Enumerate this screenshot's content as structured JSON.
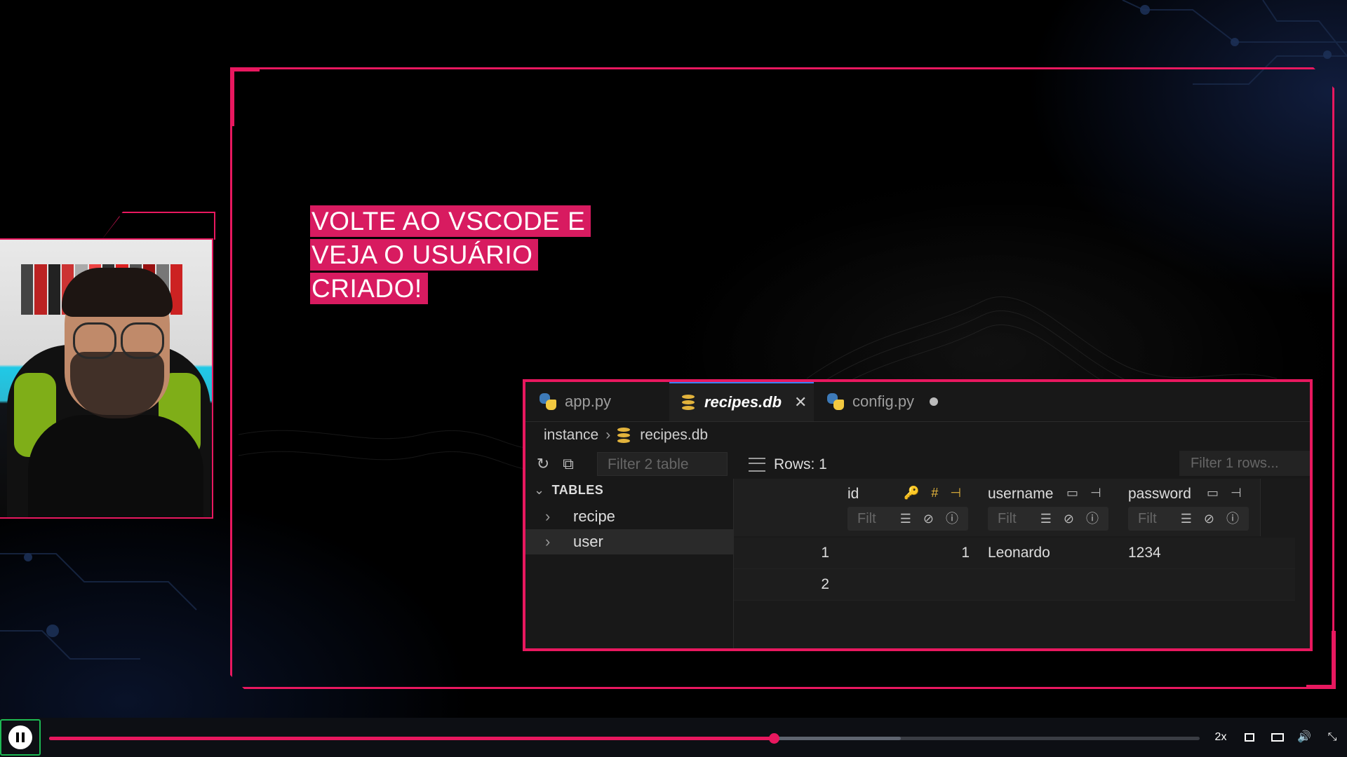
{
  "callout": {
    "lines": [
      "VOLTE AO VSCODE E",
      "VEJA O USUÁRIO",
      "CRIADO!"
    ]
  },
  "editor": {
    "tabs": [
      {
        "label": "app.py",
        "icon": "python-icon"
      },
      {
        "label": "recipes.db",
        "icon": "database-icon",
        "active": true,
        "close": "✕"
      },
      {
        "label": "config.py",
        "icon": "python-icon",
        "unsaved_indicator": "●"
      }
    ],
    "breadcrumb": {
      "folder": "instance",
      "file": "recipes.db",
      "separator": "›"
    },
    "filter_tables_placeholder": "Filter 2 table",
    "rows_label": "Rows: 1",
    "filter_rows_placeholder": "Filter 1 rows...",
    "sidebar": {
      "heading": "TABLES",
      "tables": [
        "recipe",
        "user"
      ],
      "selected_table": "user"
    },
    "grid": {
      "columns": [
        {
          "name": "id",
          "icons": "🔑 # ⊣",
          "filter_placeholder": "Filt"
        },
        {
          "name": "username",
          "icons": "▭ ⊣",
          "filter_placeholder": "Filt"
        },
        {
          "name": "password",
          "icons": "▭ ⊣",
          "filter_placeholder": "Filt"
        }
      ],
      "filter_icons": "☰ ⊘ ⓘ",
      "rows": [
        {
          "row_number": "1",
          "id": "1",
          "username": "Leonardo",
          "password": "1234"
        },
        {
          "row_number": "2",
          "id": "",
          "username": "",
          "password": ""
        }
      ]
    }
  },
  "player": {
    "progress_fraction": 0.63,
    "buffer_fraction": 0.74,
    "speed_label": "2x",
    "accent_color": "#e8185f"
  },
  "colors": {
    "frame_accent": "#e8185f",
    "callout_bg": "#d81b60"
  }
}
